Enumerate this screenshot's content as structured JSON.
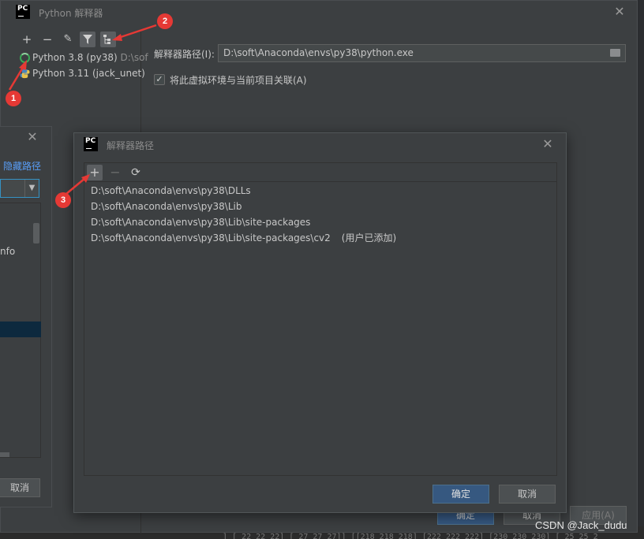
{
  "background": {
    "ide_bottom_text": "]   [ 22  22  22]   [ 27  27  27]]  [[218 218 218]   [222 222 222]   [230 230 230]        [ 25  25  2"
  },
  "main_dialog": {
    "logo": "PC",
    "title": "Python 解释器",
    "toolbar": {
      "add": "+",
      "remove": "−",
      "edit": "✎",
      "filter": "filter-icon",
      "tree": "tree-icon"
    },
    "interpreters": [
      {
        "label": "Python 3.8 (py38)",
        "suffix": "D:\\sof",
        "icon": "conda-ring-icon"
      },
      {
        "label": "Python 3.11 (jack_unet)",
        "suffix": "",
        "icon": "python-icon"
      }
    ],
    "path_label": "解释器路径(I):",
    "path_value": "D:\\soft\\Anaconda\\envs\\py38\\python.exe",
    "checkbox_label": "将此虚拟环境与当前项目关联(A)",
    "checkbox_checked": true,
    "buttons": {
      "ok": "确定",
      "cancel": "取消",
      "apply": "应用(A)"
    }
  },
  "side_dialog": {
    "link": "隐藏路径",
    "partial_text": "nfo",
    "cancel": "取消"
  },
  "path_dialog": {
    "logo": "PC",
    "title": "解释器路径",
    "toolbar": {
      "add": "+",
      "remove": "−",
      "refresh": "⟳"
    },
    "paths": [
      {
        "path": "D:\\soft\\Anaconda\\envs\\py38\\DLLs",
        "note": ""
      },
      {
        "path": "D:\\soft\\Anaconda\\envs\\py38\\Lib",
        "note": ""
      },
      {
        "path": "D:\\soft\\Anaconda\\envs\\py38\\Lib\\site-packages",
        "note": ""
      },
      {
        "path": "D:\\soft\\Anaconda\\envs\\py38\\Lib\\site-packages\\cv2",
        "note": "(用户已添加)"
      }
    ],
    "buttons": {
      "ok": "确定",
      "cancel": "取消"
    }
  },
  "annotations": {
    "badge_1": "1",
    "badge_2": "2",
    "badge_3": "3",
    "color": "#e53935"
  },
  "watermark": "CSDN @Jack_dudu"
}
